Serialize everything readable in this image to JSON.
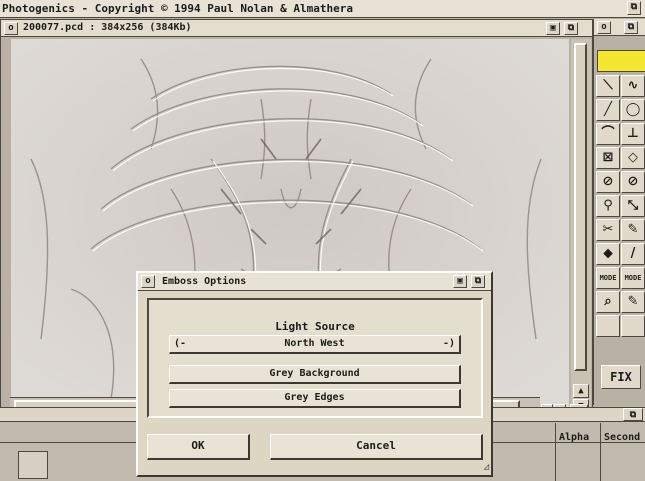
{
  "screen": {
    "title": "Photogenics - Copyright © 1994 Paul Nolan & Almathera"
  },
  "image_window": {
    "title": "200077.pcd : 384x256 (384Kb)",
    "close_glyph": "o"
  },
  "emboss_dialog": {
    "title": "Emboss Options",
    "light_source_label": "Light Source",
    "light_source_value": "North West",
    "cycle_left_glyph": "(-",
    "cycle_right_glyph": "-)",
    "grey_background_label": "Grey Background",
    "grey_edges_label": "Grey Edges",
    "ok_label": "OK",
    "cancel_label": "Cancel"
  },
  "tool_palette": {
    "close_glyph": "o",
    "swatch_color": "#f3e82f",
    "tools": [
      {
        "name": "brush-stroke-icon",
        "glyph": "⟍"
      },
      {
        "name": "freehand-icon",
        "glyph": "∿"
      },
      {
        "name": "line-icon",
        "glyph": "╱"
      },
      {
        "name": "ellipse-icon",
        "glyph": "◯"
      },
      {
        "name": "curve-icon",
        "glyph": "⌒"
      },
      {
        "name": "vertical-measure-icon",
        "glyph": "⊥"
      },
      {
        "name": "rectangle-icon",
        "glyph": "⊠"
      },
      {
        "name": "diamond-icon",
        "glyph": "◇"
      },
      {
        "name": "oval-crossed-icon",
        "glyph": "⊘"
      },
      {
        "name": "oval-filled-icon",
        "glyph": "⊘"
      },
      {
        "name": "magnify-icon",
        "glyph": "⚲"
      },
      {
        "name": "resize-icon",
        "glyph": "⤡"
      },
      {
        "name": "scissors-icon",
        "glyph": "✂"
      },
      {
        "name": "pipette-icon",
        "glyph": "✎"
      },
      {
        "name": "fill-icon",
        "glyph": "⬥"
      },
      {
        "name": "pen-icon",
        "glyph": "/"
      },
      {
        "name": "mode-icon",
        "glyph": "MODE"
      },
      {
        "name": "mode-alt-icon",
        "glyph": "MODE"
      },
      {
        "name": "brush-icon",
        "glyph": "⌕"
      },
      {
        "name": "eraser-icon",
        "glyph": "✎"
      },
      {
        "name": "blank-tool-icon",
        "glyph": ""
      },
      {
        "name": "blank-tool-2-icon",
        "glyph": ""
      }
    ],
    "fix_label": "FIX"
  },
  "layer_window": {
    "columns": [
      "Alpha",
      "Second"
    ]
  },
  "colors": {
    "desktop": "#b9b1a3",
    "titlebar": "#e3ddcd",
    "dialog": "#dcd6c3",
    "swatch": "#f3e82f"
  }
}
